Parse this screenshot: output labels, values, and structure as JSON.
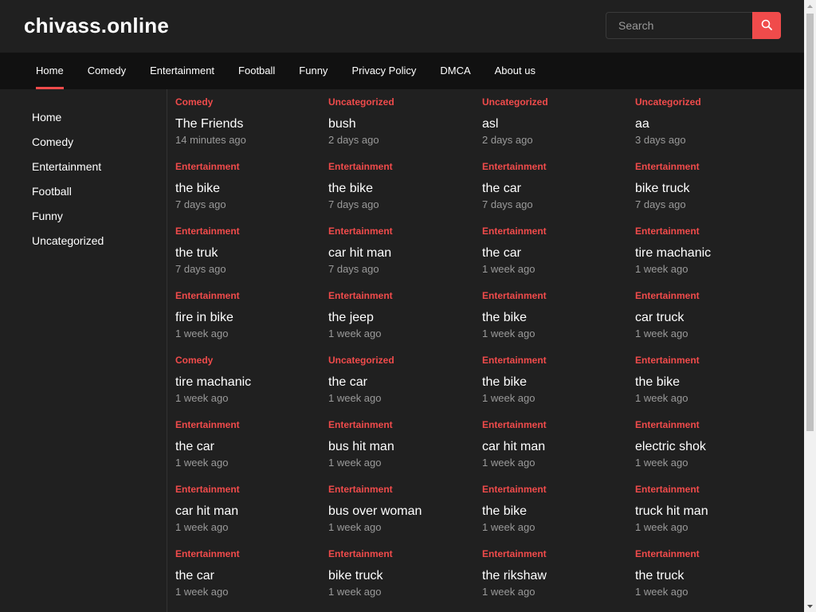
{
  "site": {
    "title": "chivass.online"
  },
  "search": {
    "placeholder": "Search"
  },
  "nav": {
    "items": [
      {
        "label": "Home",
        "active": true
      },
      {
        "label": "Comedy"
      },
      {
        "label": "Entertainment"
      },
      {
        "label": "Football"
      },
      {
        "label": "Funny"
      },
      {
        "label": "Privacy Policy"
      },
      {
        "label": "DMCA"
      },
      {
        "label": "About us"
      }
    ]
  },
  "sidebar": {
    "items": [
      {
        "label": "Home"
      },
      {
        "label": "Comedy"
      },
      {
        "label": "Entertainment"
      },
      {
        "label": "Football"
      },
      {
        "label": "Funny"
      },
      {
        "label": "Uncategorized"
      }
    ]
  },
  "posts": [
    {
      "category": "Comedy",
      "title": "The Friends",
      "time": "14 minutes ago"
    },
    {
      "category": "Uncategorized",
      "title": "bush",
      "time": "2 days ago"
    },
    {
      "category": "Uncategorized",
      "title": "asl",
      "time": "2 days ago"
    },
    {
      "category": "Uncategorized",
      "title": "aa",
      "time": "3 days ago"
    },
    {
      "category": "Entertainment",
      "title": "the bike",
      "time": "7 days ago"
    },
    {
      "category": "Entertainment",
      "title": "the bike",
      "time": "7 days ago"
    },
    {
      "category": "Entertainment",
      "title": "the car",
      "time": "7 days ago"
    },
    {
      "category": "Entertainment",
      "title": "bike truck",
      "time": "7 days ago"
    },
    {
      "category": "Entertainment",
      "title": "the truk",
      "time": "7 days ago"
    },
    {
      "category": "Entertainment",
      "title": "car hit man",
      "time": "7 days ago"
    },
    {
      "category": "Entertainment",
      "title": "the car",
      "time": "1 week ago"
    },
    {
      "category": "Entertainment",
      "title": "tire machanic",
      "time": "1 week ago"
    },
    {
      "category": "Entertainment",
      "title": "fire in bike",
      "time": "1 week ago"
    },
    {
      "category": "Entertainment",
      "title": "the jeep",
      "time": "1 week ago"
    },
    {
      "category": "Entertainment",
      "title": "the bike",
      "time": "1 week ago"
    },
    {
      "category": "Entertainment",
      "title": "car truck",
      "time": "1 week ago"
    },
    {
      "category": "Comedy",
      "title": "tire machanic",
      "time": "1 week ago"
    },
    {
      "category": "Uncategorized",
      "title": "the car",
      "time": "1 week ago"
    },
    {
      "category": "Entertainment",
      "title": "the bike",
      "time": "1 week ago"
    },
    {
      "category": "Entertainment",
      "title": "the bike",
      "time": "1 week ago"
    },
    {
      "category": "Entertainment",
      "title": "the car",
      "time": "1 week ago"
    },
    {
      "category": "Entertainment",
      "title": "bus hit man",
      "time": "1 week ago"
    },
    {
      "category": "Entertainment",
      "title": "car hit man",
      "time": "1 week ago"
    },
    {
      "category": "Entertainment",
      "title": "electric shok",
      "time": "1 week ago"
    },
    {
      "category": "Entertainment",
      "title": "car hit man",
      "time": "1 week ago"
    },
    {
      "category": "Entertainment",
      "title": "bus over woman",
      "time": "1 week ago"
    },
    {
      "category": "Entertainment",
      "title": "the bike",
      "time": "1 week ago"
    },
    {
      "category": "Entertainment",
      "title": "truck hit man",
      "time": "1 week ago"
    },
    {
      "category": "Entertainment",
      "title": "the car",
      "time": "1 week ago"
    },
    {
      "category": "Entertainment",
      "title": "bike truck",
      "time": "1 week ago"
    },
    {
      "category": "Entertainment",
      "title": "the rikshaw",
      "time": "1 week ago"
    },
    {
      "category": "Entertainment",
      "title": "the truck",
      "time": "1 week ago"
    }
  ],
  "colors": {
    "accent": "#f04b4b",
    "background": "#202020",
    "nav_background": "#111111",
    "muted": "#9a9a9a"
  },
  "icons": {
    "search": "search-icon",
    "scroll_up": "arrow-up-icon",
    "scroll_down": "arrow-down-icon"
  }
}
